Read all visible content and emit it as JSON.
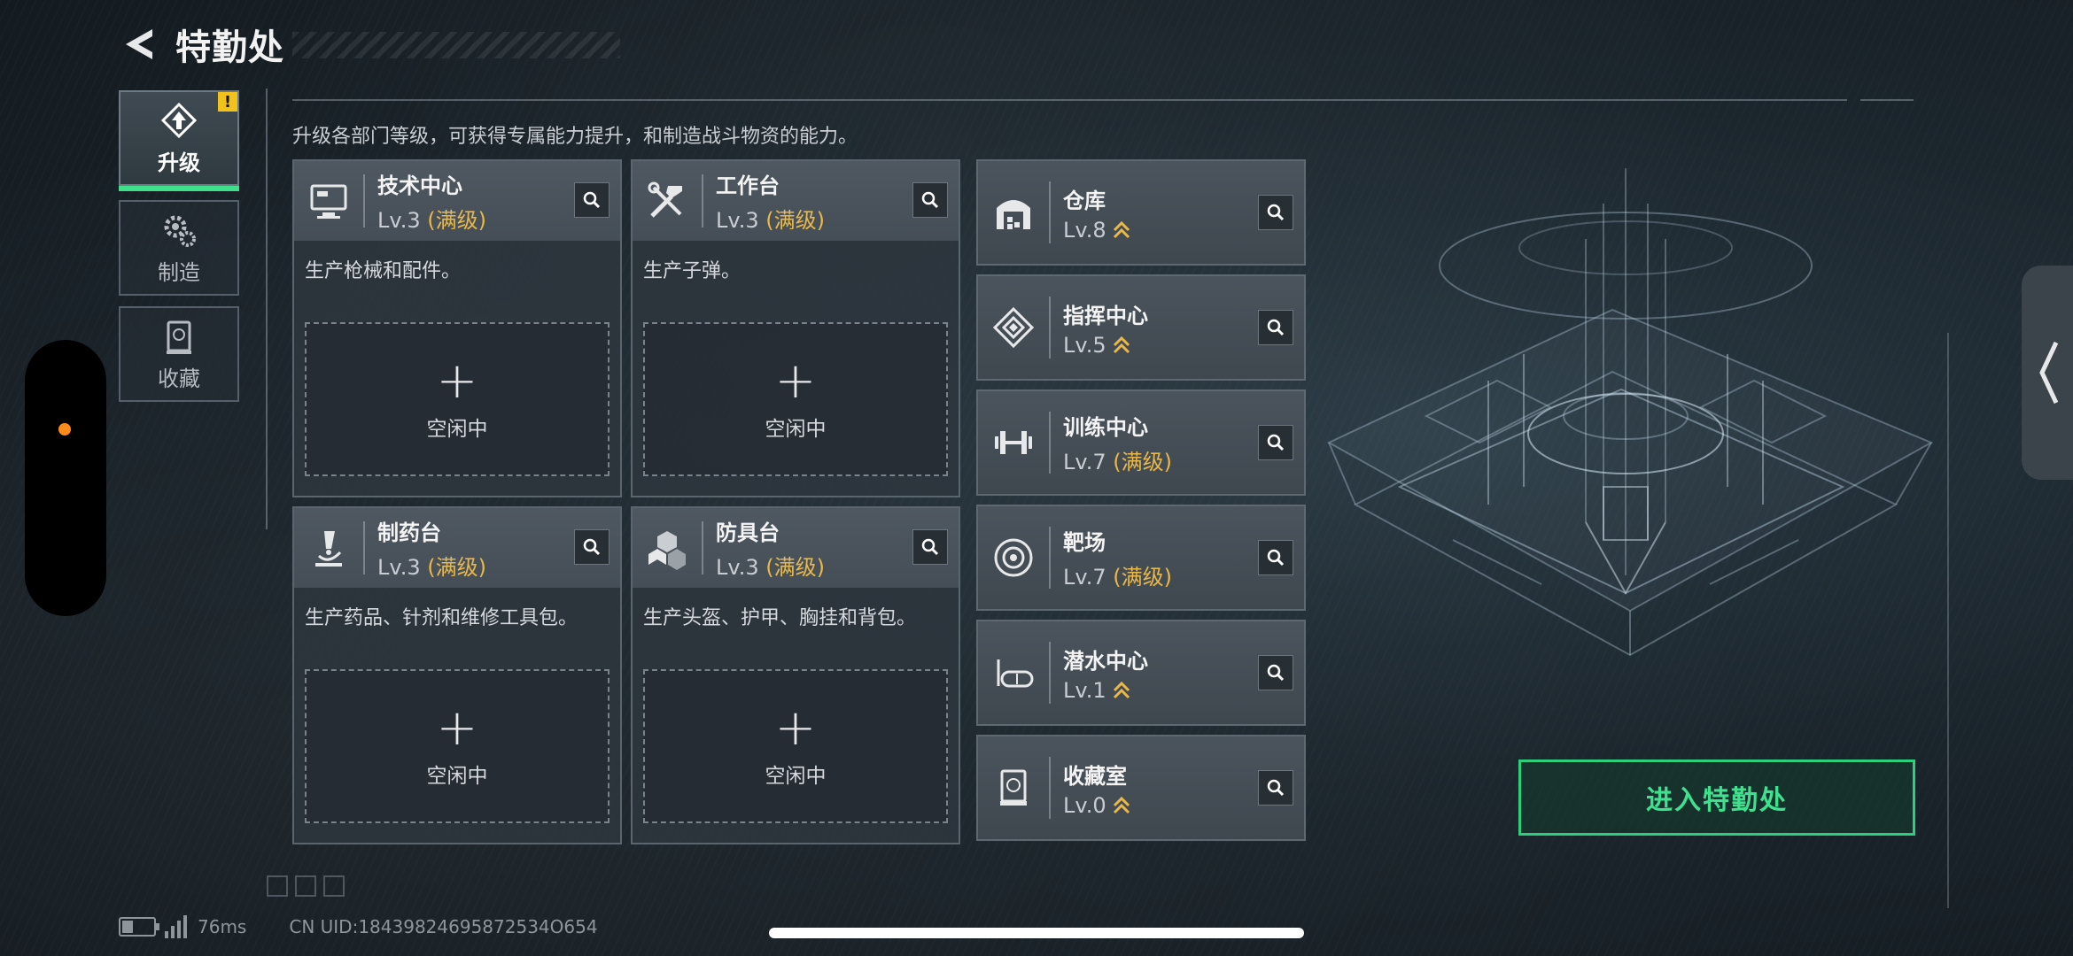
{
  "header": {
    "title": "特勤处"
  },
  "tabs": [
    {
      "label": "升级",
      "icon": "upgrade-icon",
      "active": true,
      "alert": "!"
    },
    {
      "label": "制造",
      "icon": "gear-icon",
      "active": false
    },
    {
      "label": "收藏",
      "icon": "collection-icon",
      "active": false
    }
  ],
  "description": "升级各部门等级，可获得专属能力提升，和制造战斗物资的能力。",
  "workstations": [
    {
      "name": "技术中心",
      "level": "Lv.3",
      "max_label": "(满级)",
      "desc": "生产枪械和配件。",
      "slot_plus": "+",
      "slot_label": "空闲中",
      "icon": "computer-icon"
    },
    {
      "name": "工作台",
      "level": "Lv.3",
      "max_label": "(满级)",
      "desc": "生产子弹。",
      "slot_plus": "+",
      "slot_label": "空闲中",
      "icon": "tools-icon"
    },
    {
      "name": "制药台",
      "level": "Lv.3",
      "max_label": "(满级)",
      "desc": "生产药品、针剂和维修工具包。",
      "slot_plus": "+",
      "slot_label": "空闲中",
      "icon": "microscope-icon"
    },
    {
      "name": "防具台",
      "level": "Lv.3",
      "max_label": "(满级)",
      "desc": "生产头盔、护甲、胸挂和背包。",
      "slot_plus": "+",
      "slot_label": "空闲中",
      "icon": "armor-blocks-icon"
    }
  ],
  "facilities": [
    {
      "name": "仓库",
      "level": "Lv.8",
      "max_label": "",
      "upgradable": true,
      "icon": "warehouse-icon"
    },
    {
      "name": "指挥中心",
      "level": "Lv.5",
      "max_label": "",
      "upgradable": true,
      "icon": "command-icon"
    },
    {
      "name": "训练中心",
      "level": "Lv.7",
      "max_label": "(满级)",
      "upgradable": false,
      "icon": "dumbbell-icon"
    },
    {
      "name": "靶场",
      "level": "Lv.7",
      "max_label": "(满级)",
      "upgradable": false,
      "icon": "target-icon"
    },
    {
      "name": "潜水中心",
      "level": "Lv.1",
      "max_label": "",
      "upgradable": true,
      "icon": "diving-mask-icon"
    },
    {
      "name": "收藏室",
      "level": "Lv.0",
      "max_label": "",
      "upgradable": true,
      "icon": "collection-room-icon"
    }
  ],
  "enter_button": "进入特勤处",
  "status": {
    "ping": "76ms",
    "uid": "CN UID:18439824695872534O654"
  },
  "colors": {
    "accent": "#3ee08a",
    "max": "#e8b84a",
    "alert": "#f2c21a",
    "dot": "#ff8a1c"
  }
}
